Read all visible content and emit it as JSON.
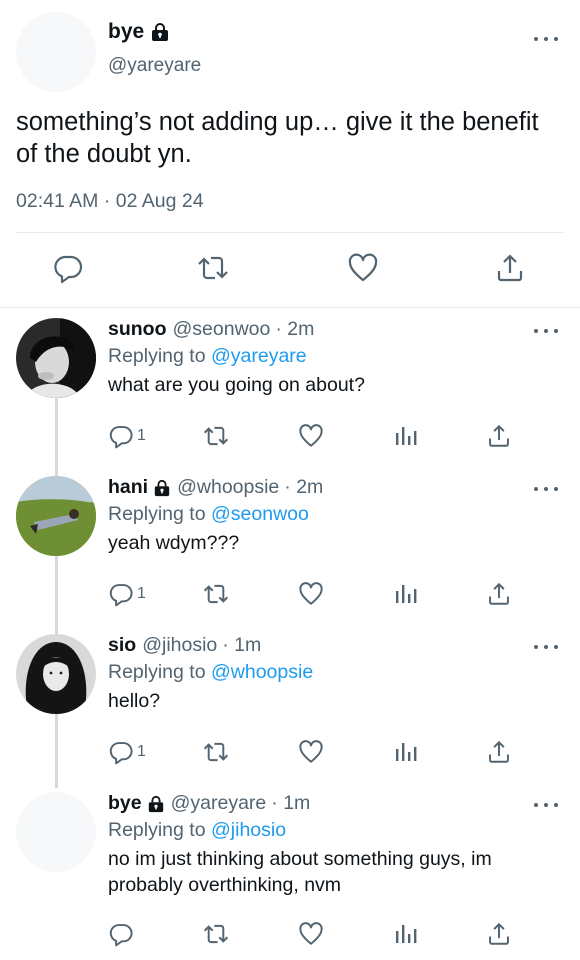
{
  "main_tweet": {
    "name": "bye",
    "handle": "@yareyare",
    "text": "something’s not adding up… give it the benefit of the doubt yn.",
    "time": "02:41 AM",
    "date": "02 Aug 24",
    "separator": "·"
  },
  "replies": [
    {
      "name": "sunoo",
      "handle": "@seonwoo",
      "age": "· 2m",
      "replying_prefix": "Replying to",
      "replying_to": "@yareyare",
      "text": "what are you going on about?",
      "reply_count": "1",
      "locked": false
    },
    {
      "name": "hani",
      "handle": "@whoopsie",
      "age": "· 2m",
      "replying_prefix": "Replying to",
      "replying_to": "@seonwoo",
      "text": "yeah wdym???",
      "reply_count": "1",
      "locked": true
    },
    {
      "name": "sio",
      "handle": "@jihosio",
      "age": "· 1m",
      "replying_prefix": "Replying to",
      "replying_to": "@whoopsie",
      "text": "hello?",
      "reply_count": "1",
      "locked": false
    },
    {
      "name": "bye",
      "handle": "@yareyare",
      "age": "· 1m",
      "replying_prefix": "Replying to",
      "replying_to": "@jihosio",
      "text": "no im just thinking about something guys, im probably overthinking, nvm",
      "reply_count": "",
      "locked": true
    }
  ],
  "colors": {
    "link": "#1d9bf0",
    "secondary_text": "#536471",
    "icon": "#536471",
    "primary_text": "#0f1419"
  }
}
